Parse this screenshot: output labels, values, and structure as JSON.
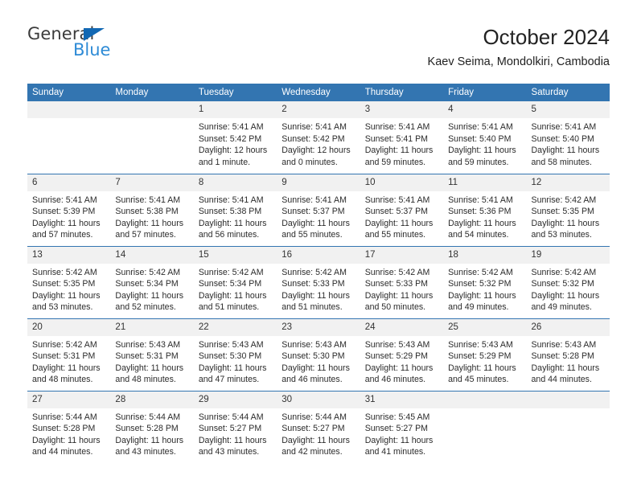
{
  "brand": {
    "name_top": "General",
    "name_bottom": "Blue",
    "triangle_color": "#1268b3",
    "top_color": "#3b3b3b",
    "bottom_color": "#2e8bd6"
  },
  "header": {
    "title": "October 2024",
    "subtitle": "Kaev Seima, Mondolkiri, Cambodia"
  },
  "colors": {
    "header_blue": "#3375b1",
    "daynum_band": "#f1f1f1",
    "text": "#2b2b2b"
  },
  "calendar": {
    "weekday_headers": [
      "Sunday",
      "Monday",
      "Tuesday",
      "Wednesday",
      "Thursday",
      "Friday",
      "Saturday"
    ],
    "weeks": [
      [
        {
          "day": "",
          "lines": []
        },
        {
          "day": "",
          "lines": []
        },
        {
          "day": "1",
          "lines": [
            "Sunrise: 5:41 AM",
            "Sunset: 5:42 PM",
            "Daylight: 12 hours",
            "and 1 minute."
          ]
        },
        {
          "day": "2",
          "lines": [
            "Sunrise: 5:41 AM",
            "Sunset: 5:42 PM",
            "Daylight: 12 hours",
            "and 0 minutes."
          ]
        },
        {
          "day": "3",
          "lines": [
            "Sunrise: 5:41 AM",
            "Sunset: 5:41 PM",
            "Daylight: 11 hours",
            "and 59 minutes."
          ]
        },
        {
          "day": "4",
          "lines": [
            "Sunrise: 5:41 AM",
            "Sunset: 5:40 PM",
            "Daylight: 11 hours",
            "and 59 minutes."
          ]
        },
        {
          "day": "5",
          "lines": [
            "Sunrise: 5:41 AM",
            "Sunset: 5:40 PM",
            "Daylight: 11 hours",
            "and 58 minutes."
          ]
        }
      ],
      [
        {
          "day": "6",
          "lines": [
            "Sunrise: 5:41 AM",
            "Sunset: 5:39 PM",
            "Daylight: 11 hours",
            "and 57 minutes."
          ]
        },
        {
          "day": "7",
          "lines": [
            "Sunrise: 5:41 AM",
            "Sunset: 5:38 PM",
            "Daylight: 11 hours",
            "and 57 minutes."
          ]
        },
        {
          "day": "8",
          "lines": [
            "Sunrise: 5:41 AM",
            "Sunset: 5:38 PM",
            "Daylight: 11 hours",
            "and 56 minutes."
          ]
        },
        {
          "day": "9",
          "lines": [
            "Sunrise: 5:41 AM",
            "Sunset: 5:37 PM",
            "Daylight: 11 hours",
            "and 55 minutes."
          ]
        },
        {
          "day": "10",
          "lines": [
            "Sunrise: 5:41 AM",
            "Sunset: 5:37 PM",
            "Daylight: 11 hours",
            "and 55 minutes."
          ]
        },
        {
          "day": "11",
          "lines": [
            "Sunrise: 5:41 AM",
            "Sunset: 5:36 PM",
            "Daylight: 11 hours",
            "and 54 minutes."
          ]
        },
        {
          "day": "12",
          "lines": [
            "Sunrise: 5:42 AM",
            "Sunset: 5:35 PM",
            "Daylight: 11 hours",
            "and 53 minutes."
          ]
        }
      ],
      [
        {
          "day": "13",
          "lines": [
            "Sunrise: 5:42 AM",
            "Sunset: 5:35 PM",
            "Daylight: 11 hours",
            "and 53 minutes."
          ]
        },
        {
          "day": "14",
          "lines": [
            "Sunrise: 5:42 AM",
            "Sunset: 5:34 PM",
            "Daylight: 11 hours",
            "and 52 minutes."
          ]
        },
        {
          "day": "15",
          "lines": [
            "Sunrise: 5:42 AM",
            "Sunset: 5:34 PM",
            "Daylight: 11 hours",
            "and 51 minutes."
          ]
        },
        {
          "day": "16",
          "lines": [
            "Sunrise: 5:42 AM",
            "Sunset: 5:33 PM",
            "Daylight: 11 hours",
            "and 51 minutes."
          ]
        },
        {
          "day": "17",
          "lines": [
            "Sunrise: 5:42 AM",
            "Sunset: 5:33 PM",
            "Daylight: 11 hours",
            "and 50 minutes."
          ]
        },
        {
          "day": "18",
          "lines": [
            "Sunrise: 5:42 AM",
            "Sunset: 5:32 PM",
            "Daylight: 11 hours",
            "and 49 minutes."
          ]
        },
        {
          "day": "19",
          "lines": [
            "Sunrise: 5:42 AM",
            "Sunset: 5:32 PM",
            "Daylight: 11 hours",
            "and 49 minutes."
          ]
        }
      ],
      [
        {
          "day": "20",
          "lines": [
            "Sunrise: 5:42 AM",
            "Sunset: 5:31 PM",
            "Daylight: 11 hours",
            "and 48 minutes."
          ]
        },
        {
          "day": "21",
          "lines": [
            "Sunrise: 5:43 AM",
            "Sunset: 5:31 PM",
            "Daylight: 11 hours",
            "and 48 minutes."
          ]
        },
        {
          "day": "22",
          "lines": [
            "Sunrise: 5:43 AM",
            "Sunset: 5:30 PM",
            "Daylight: 11 hours",
            "and 47 minutes."
          ]
        },
        {
          "day": "23",
          "lines": [
            "Sunrise: 5:43 AM",
            "Sunset: 5:30 PM",
            "Daylight: 11 hours",
            "and 46 minutes."
          ]
        },
        {
          "day": "24",
          "lines": [
            "Sunrise: 5:43 AM",
            "Sunset: 5:29 PM",
            "Daylight: 11 hours",
            "and 46 minutes."
          ]
        },
        {
          "day": "25",
          "lines": [
            "Sunrise: 5:43 AM",
            "Sunset: 5:29 PM",
            "Daylight: 11 hours",
            "and 45 minutes."
          ]
        },
        {
          "day": "26",
          "lines": [
            "Sunrise: 5:43 AM",
            "Sunset: 5:28 PM",
            "Daylight: 11 hours",
            "and 44 minutes."
          ]
        }
      ],
      [
        {
          "day": "27",
          "lines": [
            "Sunrise: 5:44 AM",
            "Sunset: 5:28 PM",
            "Daylight: 11 hours",
            "and 44 minutes."
          ]
        },
        {
          "day": "28",
          "lines": [
            "Sunrise: 5:44 AM",
            "Sunset: 5:28 PM",
            "Daylight: 11 hours",
            "and 43 minutes."
          ]
        },
        {
          "day": "29",
          "lines": [
            "Sunrise: 5:44 AM",
            "Sunset: 5:27 PM",
            "Daylight: 11 hours",
            "and 43 minutes."
          ]
        },
        {
          "day": "30",
          "lines": [
            "Sunrise: 5:44 AM",
            "Sunset: 5:27 PM",
            "Daylight: 11 hours",
            "and 42 minutes."
          ]
        },
        {
          "day": "31",
          "lines": [
            "Sunrise: 5:45 AM",
            "Sunset: 5:27 PM",
            "Daylight: 11 hours",
            "and 41 minutes."
          ]
        },
        {
          "day": "",
          "lines": []
        },
        {
          "day": "",
          "lines": []
        }
      ]
    ]
  }
}
